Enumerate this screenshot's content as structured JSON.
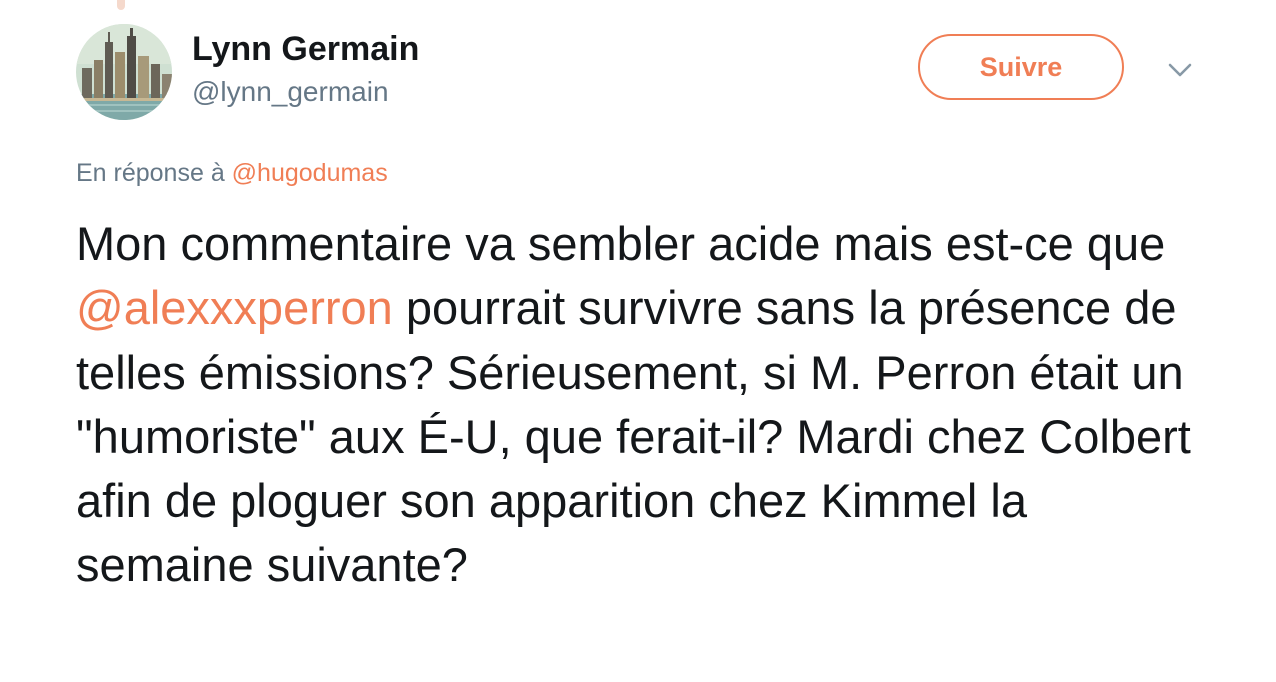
{
  "colors": {
    "accent": "#f07e55",
    "text_primary": "#14171a",
    "text_secondary": "#657786"
  },
  "author": {
    "name": "Lynn Germain",
    "handle": "@lynn_germain"
  },
  "follow_button": {
    "label": "Suivre"
  },
  "menu": {
    "icon": "chevron-down-icon"
  },
  "reply": {
    "prefix": "En réponse à ",
    "mention": "@hugodumas"
  },
  "tweet": {
    "text_before_mention": "Mon commentaire va sembler acide mais est-ce que ",
    "mention": "@alexxxperron",
    "text_after_mention": " pourrait survivre sans la présence de telles émissions? Sérieusement, si M. Perron était un \"humoriste\" aux É-U, que ferait-il? Mardi chez Colbert afin de ploguer son apparition chez Kimmel la semaine suivante?"
  }
}
